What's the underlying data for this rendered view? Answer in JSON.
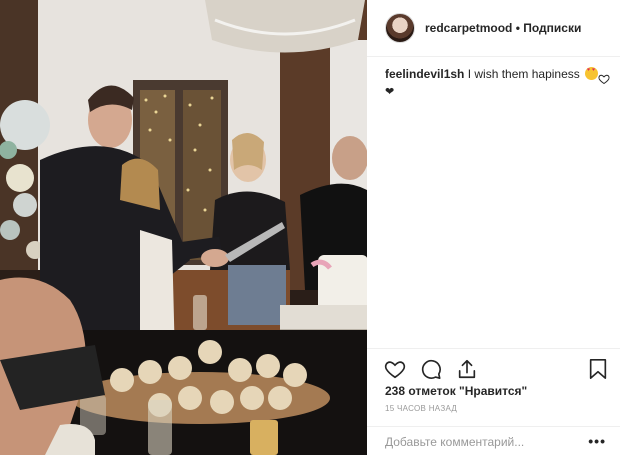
{
  "post": {
    "author": "redcarpetmood",
    "separator": "•",
    "follow_label": "Подписки",
    "photo_alt": "Фото"
  },
  "comments": [
    {
      "username": "feelindevil1sh",
      "text": "I wish them hapiness",
      "emoji": "heart-eyes-emoji",
      "trailing_emoji": "❤"
    }
  ],
  "actions": {
    "likes_text": "238 отметок \"Нравится\"",
    "time_text": "15 ЧАСОВ НАЗАД",
    "comment_placeholder": "Добавьте комментарий...",
    "more_label": "•••"
  },
  "icons": [
    "heart-icon",
    "comment-icon",
    "share-icon",
    "bookmark-icon",
    "like-comment-icon",
    "more-options-icon"
  ],
  "colors": {
    "text": "#262626",
    "muted": "#999999",
    "border": "#efefef"
  }
}
